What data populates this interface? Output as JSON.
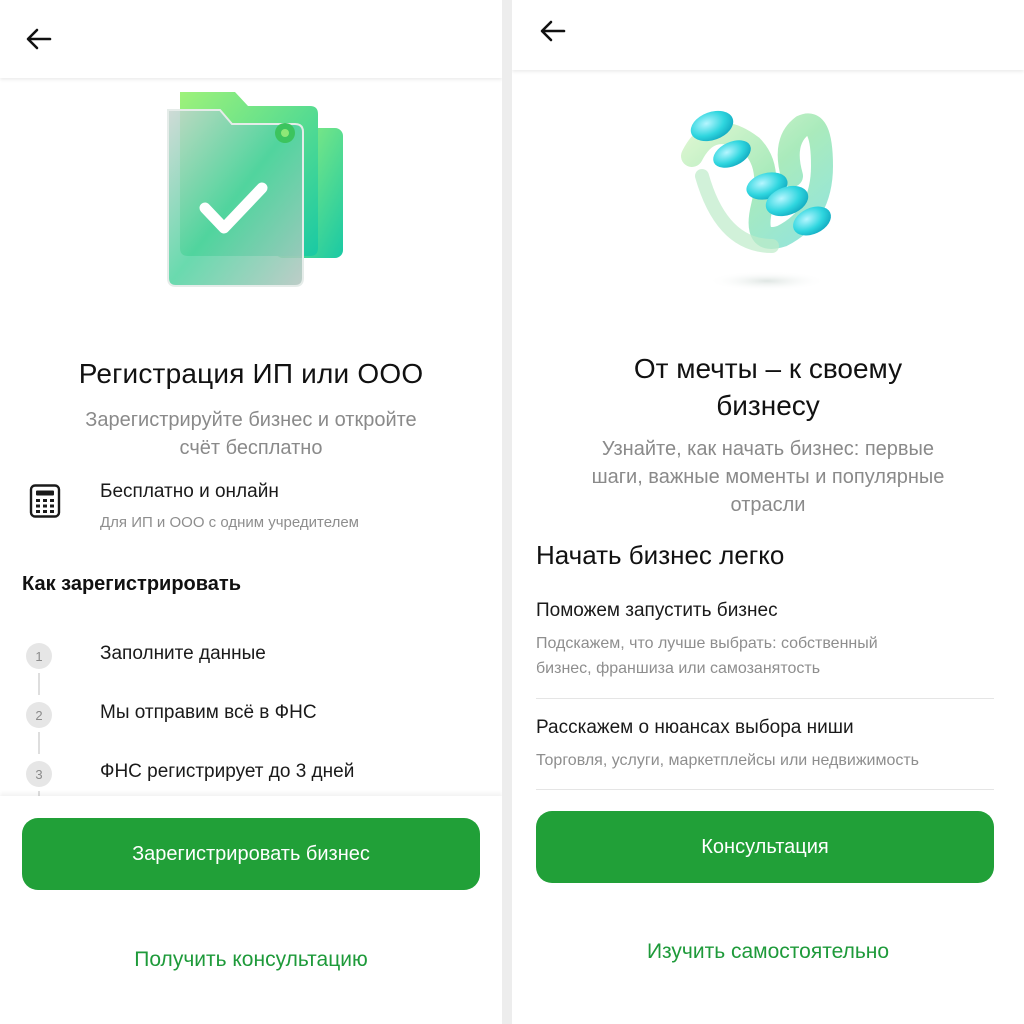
{
  "left": {
    "title": "Регистрация ИП или ООО",
    "subtitle_line1": "Зарегистрируйте бизнес и откройте",
    "subtitle_line2": "счёт бесплатно",
    "feature": {
      "icon": "calculator-icon",
      "title": "Бесплатно и онлайн",
      "description": "Для ИП и ООО с одним учредителем"
    },
    "howto_heading": "Как зарегистрировать",
    "steps": [
      {
        "number": "1",
        "label": "Заполните данные"
      },
      {
        "number": "2",
        "label": "Мы отправим всё в ФНС"
      },
      {
        "number": "3",
        "label": "ФНС регистрирует до 3 дней"
      }
    ],
    "primary_button": "Зарегистрировать бизнес",
    "secondary_link": "Получить консультацию"
  },
  "right": {
    "title_line1": "От мечты – к своему",
    "title_line2": "бизнесу",
    "subtitle_line1": "Узнайте, как начать бизнес: первые",
    "subtitle_line2": "шаги, важные моменты и популярные",
    "subtitle_line3": "отрасли",
    "section_heading": "Начать бизнес легко",
    "items": [
      {
        "title": "Поможем запустить бизнес",
        "desc_line1": "Подскажем, что лучше выбрать: собственный",
        "desc_line2": "бизнес, франшиза или самозанятость"
      },
      {
        "title": "Расскажем о нюансах выбора ниши",
        "desc_line1": "Торговля, услуги, маркетплейсы или недвижимость",
        "desc_line2": ""
      }
    ],
    "primary_button": "Консультация",
    "secondary_link": "Изучить самостоятельно"
  },
  "colors": {
    "accent": "#21a038",
    "link": "#1e9a3a",
    "muted_text": "#8a8a8a"
  }
}
